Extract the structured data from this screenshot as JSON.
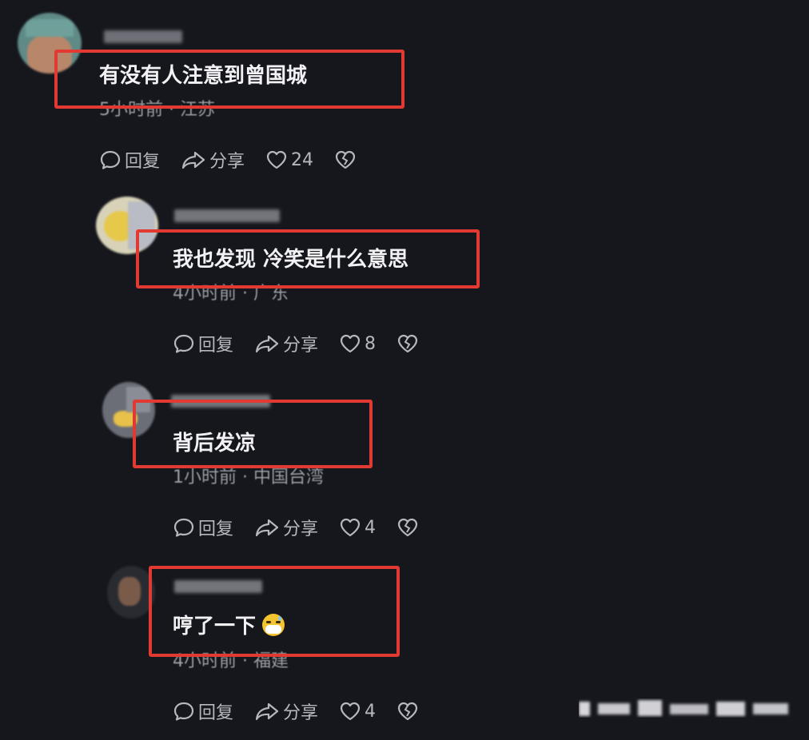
{
  "comments": [
    {
      "content": "有没有人注意到曾国城",
      "meta": "5小时前 · 江苏",
      "actions": {
        "reply_label": "回复",
        "share_label": "分享",
        "likes": "24"
      }
    },
    {
      "content": "我也发现 冷笑是什么意思",
      "meta": "4小时前 · 广东",
      "actions": {
        "reply_label": "回复",
        "share_label": "分享",
        "likes": "8"
      }
    },
    {
      "content": "背后发凉",
      "meta": "1小时前 · 中国台湾",
      "actions": {
        "reply_label": "回复",
        "share_label": "分享",
        "likes": "4"
      }
    },
    {
      "content": "哼了一下",
      "meta": "4小时前 · 福建",
      "actions": {
        "reply_label": "回复",
        "share_label": "分享",
        "likes": "4"
      }
    }
  ],
  "icons": {
    "reply": "speech-bubble-icon",
    "share": "share-arrow-icon",
    "like": "heart-icon",
    "dislike": "broken-heart-icon"
  },
  "colors": {
    "background": "#15171d",
    "highlight_box": "#e23a33",
    "content_text": "#f2f2f4",
    "meta_text": "#9a9ca4"
  }
}
